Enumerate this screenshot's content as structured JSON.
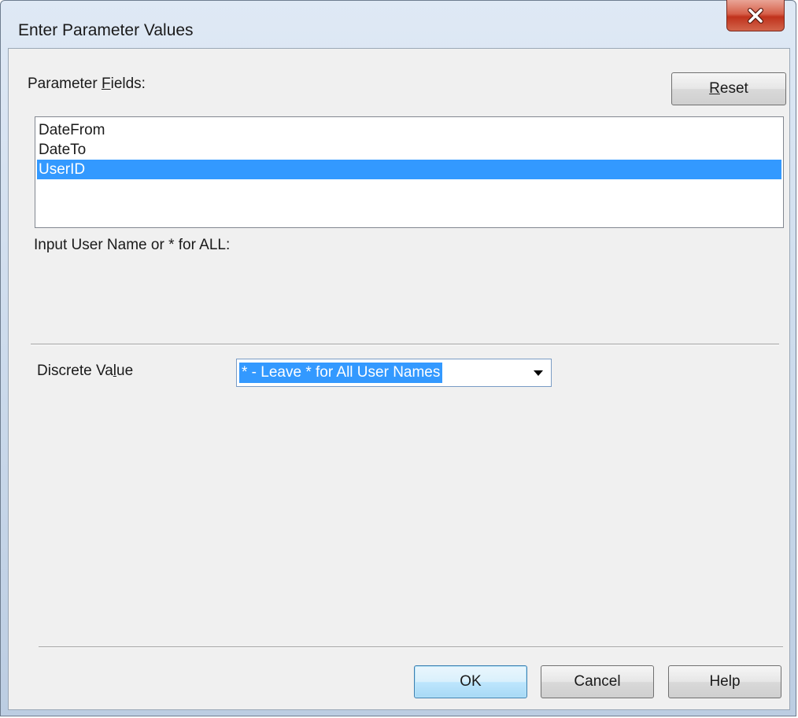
{
  "window": {
    "title": "Enter Parameter Values"
  },
  "parameter_fields": {
    "label_prefix": "Parameter ",
    "label_mnemonic": "F",
    "label_suffix": "ields:",
    "items": [
      "DateFrom",
      "DateTo",
      "UserID"
    ],
    "selected": "UserID"
  },
  "reset_button": {
    "mnemonic": "R",
    "rest": "eset"
  },
  "prompt": {
    "text": "Input User Name or * for ALL:"
  },
  "discrete_value": {
    "label_prefix": "Discrete Va",
    "label_mnemonic": "l",
    "label_suffix": "ue",
    "value": "* - Leave * for All User Names"
  },
  "footer": {
    "ok_label": "OK",
    "cancel_label": "Cancel",
    "help_label": "Help"
  },
  "colors": {
    "selection": "#3399ff",
    "close_button": "#c7412b",
    "dialog_background": "#f0f0f0"
  },
  "icons": {
    "close": "close-icon",
    "dropdown": "chevron-down-icon"
  }
}
